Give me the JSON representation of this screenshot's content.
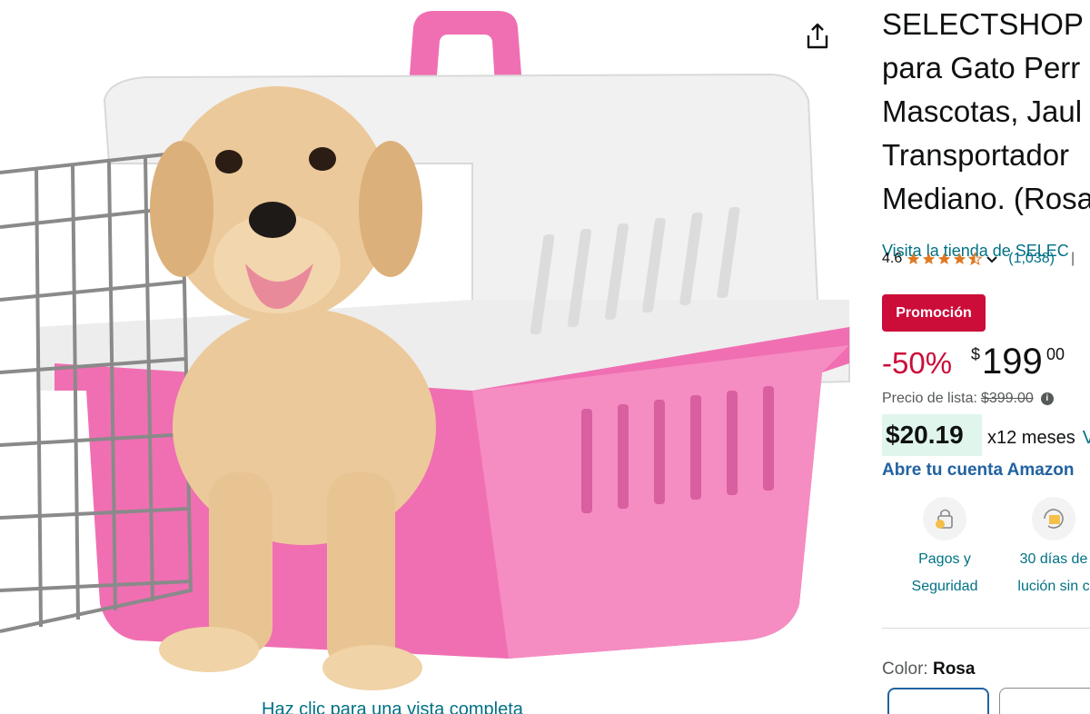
{
  "image_pane": {
    "view_full_label": "Haz clic para una vista completa",
    "share_icon": "share-icon"
  },
  "product": {
    "title_lines": [
      "SELECTSHOP J",
      "para Gato Perr",
      "Mascotas, Jaul",
      "Transportador",
      "Mediano. (Rosa"
    ],
    "store_link": "Visita la tienda de SELEC",
    "rating": {
      "value": "4.6",
      "stars": 4.6,
      "count": "(1,038)",
      "separator": "|"
    },
    "promo_badge": "Promoción",
    "price": {
      "discount": "-50%",
      "currency_symbol": "$",
      "whole": "199",
      "fraction": "00"
    },
    "list_price": {
      "label": "Precio de lista:",
      "value": "$399.00"
    },
    "installments": {
      "amount": "$20.19",
      "months": "x12 meses",
      "more": "V"
    },
    "account_link": "Abre tu cuenta Amazon",
    "features": [
      {
        "icon": "secure-payment-icon",
        "line1": "Pagos y",
        "line2": "Seguridad"
      },
      {
        "icon": "return-box-icon",
        "line1": "30 días de",
        "line2": "lución sin c"
      }
    ],
    "color": {
      "label": "Color:",
      "value": "Rosa"
    }
  },
  "colors": {
    "link": "#007185",
    "promo": "#cc0c39",
    "account_link": "#2162a1",
    "star": "#de7921",
    "installment_bg": "#e0f5ec",
    "carrier_pink": "#f06fb2",
    "carrier_white": "#f1f1f1"
  }
}
